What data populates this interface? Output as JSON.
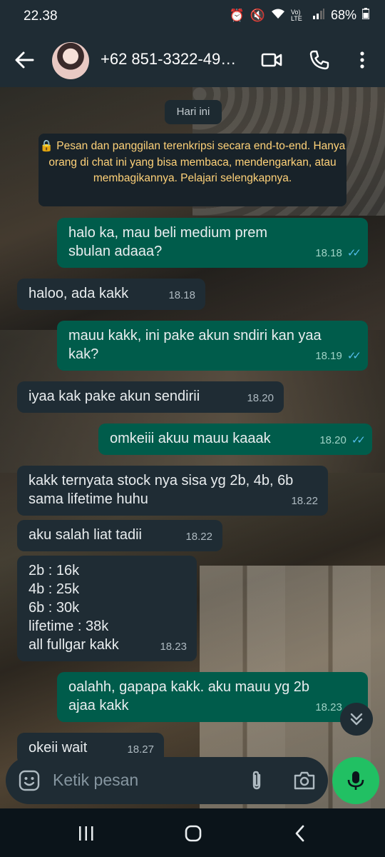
{
  "status_bar": {
    "time": "22.38",
    "battery": "68%",
    "network": "Vo) LTE"
  },
  "header": {
    "contact": "+62 851-3322-49…"
  },
  "date_divider": "Hari ini",
  "encryption_notice": "🔒 Pesan dan panggilan terenkripsi secara end-to-end. Hanya orang di chat ini yang bisa membaca, mendengarkan, atau membagikannya. Pelajari selengkapnya.",
  "messages": [
    {
      "dir": "out",
      "text": "halo ka, mau beli medium prem sbulan adaaa?",
      "time": "18.18",
      "read": true
    },
    {
      "dir": "in",
      "text": "haloo, ada kakk",
      "time": "18.18"
    },
    {
      "dir": "out",
      "text": "mauu kakk, ini pake akun sndiri kan yaa kak?",
      "time": "18.19",
      "read": true
    },
    {
      "dir": "in",
      "text": "iyaa kak pake akun sendirii",
      "time": "18.20"
    },
    {
      "dir": "out",
      "text": "omkeiii akuu mauu kaaak",
      "time": "18.20",
      "read": true
    },
    {
      "dir": "in",
      "text": "kakk ternyata stock nya sisa yg 2b, 4b, 6b sama lifetime huhu",
      "time": "18.22"
    },
    {
      "dir": "in",
      "text": "aku salah liat tadii",
      "time": "18.22"
    },
    {
      "dir": "in",
      "text": "2b : 16k\n4b : 25k\n6b : 30k\nlifetime : 38k\nall fullgar kakk",
      "time": "18.23"
    },
    {
      "dir": "out",
      "text": "oalahh, gapapa kakk. aku mauu yg 2b ajaa kakk",
      "time": "18.23",
      "read": true
    },
    {
      "dir": "in",
      "text": "okeii wait",
      "time": "18.27"
    }
  ],
  "composer": {
    "placeholder": "Ketik pesan"
  },
  "colors": {
    "incoming": "#1f2c34",
    "outgoing": "#005c4b",
    "accent": "#21c063",
    "read_ticks": "#53bdeb"
  }
}
